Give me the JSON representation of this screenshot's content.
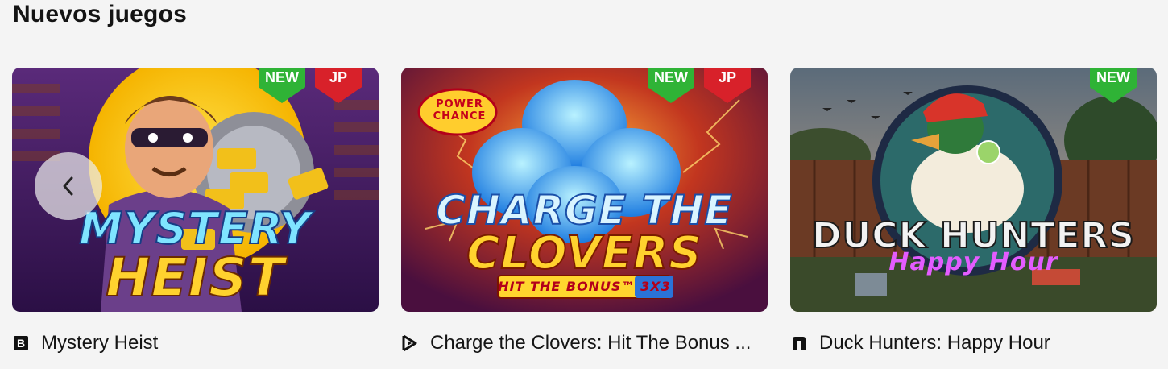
{
  "section": {
    "title": "Nuevos juegos"
  },
  "carousel": {
    "prev_icon": "chevron-left-icon"
  },
  "games": [
    {
      "name": "Mystery Heist",
      "thumb_line1": "MYSTERY",
      "thumb_line2": "HEIST",
      "badges": {
        "new": "NEW",
        "jp": "JP"
      },
      "provider_icon": "provider-b-icon"
    },
    {
      "name": "Charge the Clovers: Hit The Bonus ...",
      "thumb_logo": "POWER Chance",
      "thumb_line1": "CHARGE THE",
      "thumb_line2": "CLOVERS",
      "thumb_line3": "HIT the BONUS™ 3x3",
      "badges": {
        "new": "NEW",
        "jp": "JP"
      },
      "provider_icon": "provider-play-icon"
    },
    {
      "name": "Duck Hunters: Happy Hour",
      "thumb_line1": "DUCK HUNTERS",
      "thumb_line2": "Happy Hour",
      "badges": {
        "new": "NEW"
      },
      "provider_icon": "provider-n-icon"
    }
  ]
}
